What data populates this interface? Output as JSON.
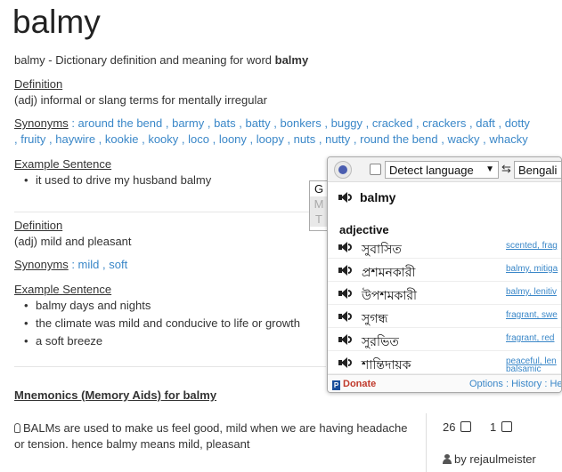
{
  "title": "balmy",
  "subtitle_prefix": "balmy - Dictionary definition and meaning for word ",
  "subtitle_word": "balmy",
  "definition_label": "Definition",
  "synonyms_label": "Synonyms",
  "example_label": "Example Sentence",
  "sense1": {
    "definition": "(adj) informal or slang terms for mentally irregular",
    "synonyms_line1": [
      "around the bend",
      "barmy",
      "bats",
      "batty",
      "bonkers",
      "buggy",
      "cracked",
      "crackers",
      "daft",
      "dotty"
    ],
    "synonyms_line2": [
      "fruity",
      "haywire",
      "kookie",
      "kooky",
      "loco",
      "loony",
      "loopy",
      "nuts",
      "nutty",
      "round the bend",
      "wacky",
      "whacky"
    ],
    "examples": [
      "it used to drive my husband balmy"
    ]
  },
  "sense2": {
    "definition": "(adj) mild and pleasant",
    "synonyms": [
      "mild",
      "soft"
    ],
    "examples": [
      "balmy days and nights",
      "the climate was mild and conducive to life or growth",
      "a soft breeze"
    ]
  },
  "mnemonics": {
    "title": "Mnemonics (Memory Aids) for balmy",
    "text": "BALMs are used to make us feel good, mild when we are having headache or tension. hence balmy means mild, pleasant",
    "upvotes": "26",
    "downvotes": "1",
    "author": "by rejaulmeister"
  },
  "popup": {
    "source_language": "Detect language",
    "swap": "⇆",
    "target_language": "Bengali",
    "word": "balmy",
    "part_of_speech": "adjective",
    "rows": [
      {
        "bn": "সুবাসিত",
        "en": "scented, frag"
      },
      {
        "bn": "প্রশমনকারী",
        "en": "balmy, mitiga"
      },
      {
        "bn": "উপশমকারী",
        "en": "balmy, lenitiv"
      },
      {
        "bn": "সুগন্ধ",
        "en": "fragrant, swe"
      },
      {
        "bn": "সুরভিত",
        "en": "fragrant, red"
      },
      {
        "bn": "শান্তিদায়ক",
        "en": "peaceful, len"
      }
    ],
    "overflow_text": "balsamic",
    "donate": "Donate",
    "paypal_glyph": "P",
    "footer_links": "Options : History : He",
    "tab_g": "G",
    "tab_m": "M",
    "tab_t": "T"
  },
  "colors": {
    "link": "#3a87c8",
    "text": "#333333",
    "donate": "#c0392b"
  }
}
